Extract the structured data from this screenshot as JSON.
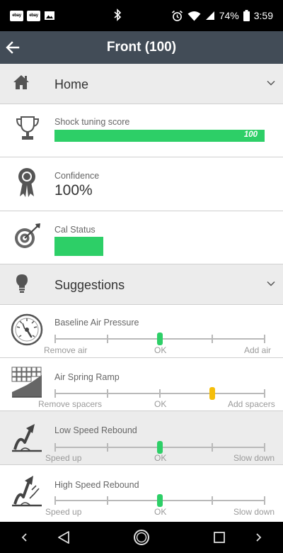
{
  "status_bar": {
    "notif_1": "ebay",
    "notif_2": "ebay",
    "battery": "74%",
    "time": "3:59",
    "icons": [
      "image-icon",
      "bluetooth-icon",
      "alarm-icon",
      "wifi-icon",
      "signal-icon",
      "battery-icon"
    ]
  },
  "app_bar": {
    "title": "Front (100)",
    "back_icon": "back-arrow-icon"
  },
  "home_section": {
    "title": "Home",
    "icon": "house-icon"
  },
  "shock_score": {
    "label": "Shock tuning score",
    "value": "100",
    "fill_fraction": 1.0,
    "icon": "trophy-icon"
  },
  "confidence": {
    "label": "Confidence",
    "value": "100%",
    "icon": "ribbon-award-icon"
  },
  "cal_status": {
    "label": "Cal Status",
    "status_color": "#2dcf67",
    "icon": "target-icon"
  },
  "suggestions_section": {
    "title": "Suggestions",
    "icon": "lightbulb-icon"
  },
  "suggestions": [
    {
      "title": "Baseline Air Pressure",
      "left": "Remove air",
      "mid": "OK",
      "right": "Add air",
      "position": 0.5,
      "color": "#2dcf67",
      "icon": "pressure-gauge-icon"
    },
    {
      "title": "Air Spring Ramp",
      "left": "Remove spacers",
      "mid": "OK",
      "right": "Add spacers",
      "position": 0.75,
      "color": "#f5be0b",
      "icon": "spring-ramp-icon"
    },
    {
      "title": "Low Speed Rebound",
      "left": "Speed up",
      "mid": "OK",
      "right": "Slow down",
      "position": 0.5,
      "color": "#2dcf67",
      "icon": "low-speed-rebound-icon"
    },
    {
      "title": "High Speed Rebound",
      "left": "Speed up",
      "mid": "OK",
      "right": "Slow down",
      "position": 0.5,
      "color": "#2dcf67",
      "icon": "high-speed-rebound-icon"
    }
  ],
  "nav_bar": {
    "icons": [
      "nav-left-icon",
      "back-triangle-icon",
      "home-circle-icon",
      "recents-square-icon",
      "nav-right-icon"
    ]
  },
  "colors": {
    "accent_green": "#2dcf67",
    "warning_yellow": "#f5be0b",
    "app_bar": "#424c57"
  }
}
